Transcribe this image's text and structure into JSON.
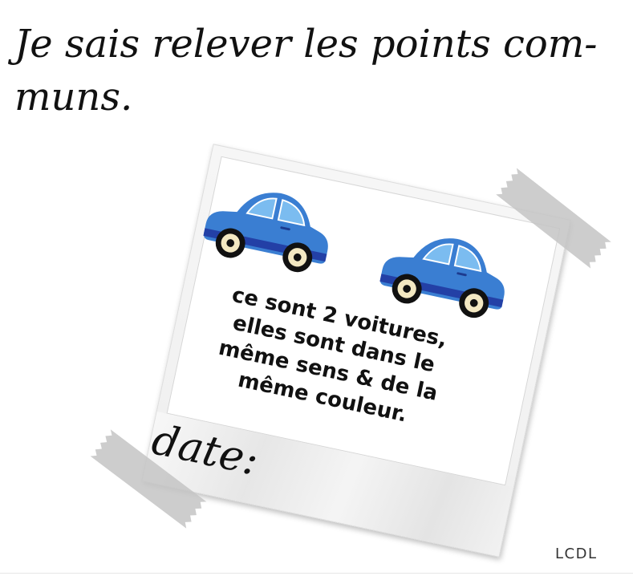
{
  "title": {
    "line1": "Je sais relever les points com-",
    "line2": "muns."
  },
  "card": {
    "cars": [
      {
        "icon": "car-icon"
      },
      {
        "icon": "car-icon"
      }
    ],
    "caption_lines": [
      "ce sont 2 voitures,",
      "elles sont dans le",
      "même sens & de la",
      "même couleur."
    ],
    "date_label": "date:"
  },
  "footer": {
    "credit": "LCDL"
  },
  "colors": {
    "car_body": "#3a7ed2",
    "car_stripe": "#2340a6",
    "car_window": "#7bbcf0",
    "wheel_rim": "#f3e8c2",
    "tape": "#c4c4c4"
  }
}
